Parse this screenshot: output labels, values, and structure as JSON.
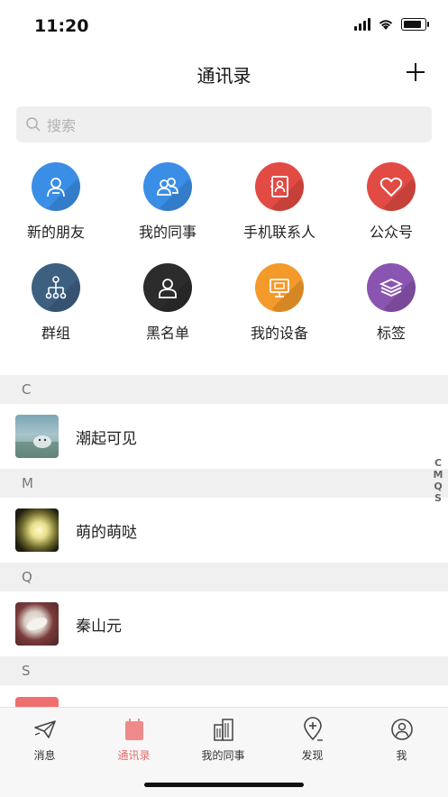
{
  "status": {
    "time": "11:20"
  },
  "header": {
    "title": "通讯录",
    "add_icon": "plus-icon"
  },
  "search": {
    "placeholder": "搜索"
  },
  "grid": [
    {
      "label": "新的朋友",
      "icon": "new-friend-icon",
      "color": "#3a8ee6"
    },
    {
      "label": "我的同事",
      "icon": "colleagues-icon",
      "color": "#3a8ee6"
    },
    {
      "label": "手机联系人",
      "icon": "phone-contacts-icon",
      "color": "#e14b43"
    },
    {
      "label": "公众号",
      "icon": "official-account-icon",
      "color": "#e14b43"
    },
    {
      "label": "群组",
      "icon": "group-icon",
      "color": "#3d5f80"
    },
    {
      "label": "黑名单",
      "icon": "blacklist-icon",
      "color": "#2c2c2c"
    },
    {
      "label": "我的设备",
      "icon": "device-icon",
      "color": "#f39a2b"
    },
    {
      "label": "标签",
      "icon": "tag-icon",
      "color": "#8a55b0"
    }
  ],
  "sections": [
    {
      "letter": "C",
      "contacts": [
        {
          "name": "潮起可见"
        }
      ]
    },
    {
      "letter": "M",
      "contacts": [
        {
          "name": "萌的萌哒"
        }
      ]
    },
    {
      "letter": "Q",
      "contacts": [
        {
          "name": "秦山元"
        }
      ]
    },
    {
      "letter": "S",
      "contacts": []
    }
  ],
  "index_letters": [
    "C",
    "M",
    "Q",
    "S"
  ],
  "tabs": [
    {
      "label": "消息",
      "icon": "message-icon",
      "active": false
    },
    {
      "label": "通讯录",
      "icon": "contacts-icon",
      "active": true
    },
    {
      "label": "我的同事",
      "icon": "building-icon",
      "active": false
    },
    {
      "label": "发现",
      "icon": "discover-icon",
      "active": false
    },
    {
      "label": "我",
      "icon": "profile-icon",
      "active": false
    }
  ],
  "colors": {
    "accent": "#e56b6b",
    "section_bg": "#f0f0f0",
    "search_bg": "#efefef"
  }
}
